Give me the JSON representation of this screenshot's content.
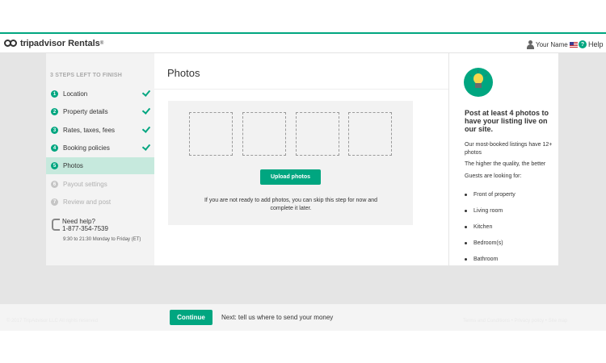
{
  "header": {
    "logo_trip": "trip",
    "logo_advisor": "advisor",
    "logo_rentals": "Rentals",
    "logo_reg": "®",
    "user_name": "Your Name",
    "help_label": "Help",
    "help_icon_char": "?"
  },
  "sidebar": {
    "steps_left": "3 STEPS LEFT TO FINISH",
    "steps": [
      {
        "num": "1",
        "label": "Location",
        "status": "complete"
      },
      {
        "num": "2",
        "label": "Property details",
        "status": "complete"
      },
      {
        "num": "3",
        "label": "Rates, taxes, fees",
        "status": "complete"
      },
      {
        "num": "4",
        "label": "Booking policies",
        "status": "complete"
      },
      {
        "num": "5",
        "label": "Photos",
        "status": "active"
      },
      {
        "num": "6",
        "label": "Payout settings",
        "status": "pending"
      },
      {
        "num": "7",
        "label": "Review and post",
        "status": "pending"
      }
    ],
    "need_help": "Need help?",
    "phone": "1-877-354-7539",
    "hours": "9:30 to 21:30 Monday to Friday (ET)"
  },
  "main": {
    "title": "Photos",
    "upload_label": "Upload photos",
    "skip_text": "If you are not ready to add photos, you can skip this step for now and complete it later."
  },
  "tips": {
    "title": "Post at least 4 photos to have your listing live on our site.",
    "p1": "Our most-booked listings have 12+ photos",
    "p2": "The higher the quality, the better",
    "p3": "Guests are looking for:",
    "items": [
      "Front of property",
      "Living room",
      "Kitchen",
      "Bedroom(s)",
      "Bathroom"
    ]
  },
  "footer": {
    "continue_label": "Continue",
    "next_text": "Next: tell us where to send your money",
    "left_text": "© 2017 TripAdvisor LLC All rights reserved",
    "right_text": "Terms and Conditions • Privacy policy • Site map"
  },
  "colors": {
    "accent": "#00a680",
    "active_step_bg": "#c6e9dd",
    "page_bg": "#e5e5e5"
  }
}
